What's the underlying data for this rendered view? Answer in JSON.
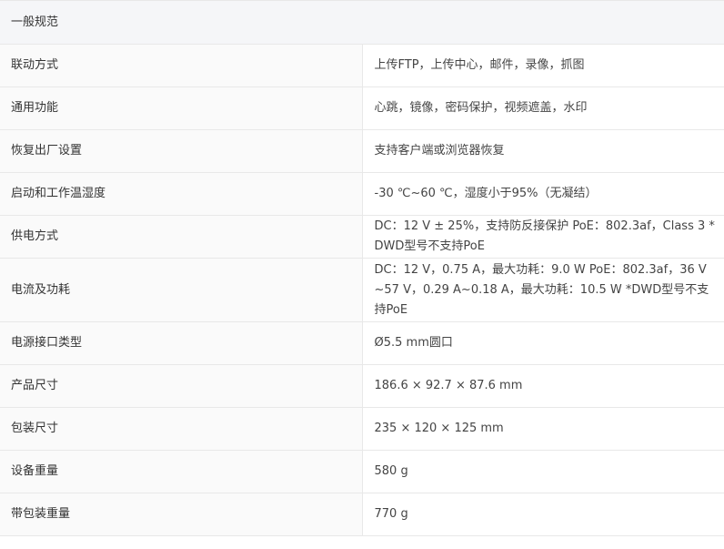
{
  "section": {
    "title": "一般规范"
  },
  "rows": [
    {
      "label": "联动方式",
      "value": "上传FTP，上传中心，邮件，录像，抓图"
    },
    {
      "label": "通用功能",
      "value": "心跳，镜像，密码保护，视频遮盖，水印"
    },
    {
      "label": "恢复出厂设置",
      "value": "支持客户端或浏览器恢复"
    },
    {
      "label": "启动和工作温湿度",
      "value": "-30 ℃~60 ℃，湿度小于95%（无凝结）"
    },
    {
      "label": "供电方式",
      "value": "DC：12 V ± 25%，支持防反接保护 PoE：802.3af，Class 3 *DWD型号不支持PoE"
    },
    {
      "label": "电流及功耗",
      "value": "DC：12 V，0.75 A，最大功耗：9.0 W PoE：802.3af，36 V~57 V，0.29 A~0.18 A，最大功耗：10.5 W *DWD型号不支持PoE"
    },
    {
      "label": "电源接口类型",
      "value": "Ø5.5 mm圆口"
    },
    {
      "label": "产品尺寸",
      "value": "186.6 × 92.7 × 87.6 mm"
    },
    {
      "label": "包装尺寸",
      "value": "235 × 120 × 125 mm"
    },
    {
      "label": "设备重量",
      "value": "580 g"
    },
    {
      "label": "带包装重量",
      "value": "770 g"
    }
  ]
}
